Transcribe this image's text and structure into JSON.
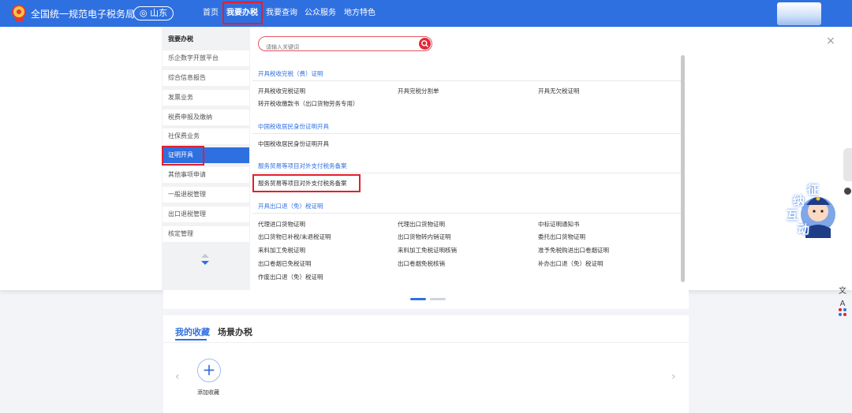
{
  "header": {
    "brand_title": "全国统一规范电子税务局",
    "region_label": "山东",
    "nav_items": [
      {
        "label": "首页"
      },
      {
        "label": "我要办税",
        "active": true
      },
      {
        "label": "我要查询"
      },
      {
        "label": "公众服务"
      },
      {
        "label": "地方特色"
      }
    ]
  },
  "sidebar": {
    "title": "我要办税",
    "items": [
      {
        "label": "乐企数字开放平台"
      },
      {
        "label": "综合信息报告"
      },
      {
        "label": "发票业务"
      },
      {
        "label": "税费申报及缴纳"
      },
      {
        "label": "社保费业务"
      },
      {
        "label": "证明开具",
        "active": true
      },
      {
        "label": "其他事项申请"
      },
      {
        "label": "一般退税管理"
      },
      {
        "label": "出口退税管理"
      },
      {
        "label": "核定管理"
      }
    ]
  },
  "search": {
    "placeholder": "请输入关键词"
  },
  "sections": [
    {
      "title": "开具税收完税（费）证明",
      "items": [
        "开具税收完税证明",
        "开具完税分割单",
        "开具无欠税证明",
        "转开税收缴款书（出口货物劳务专用）"
      ]
    },
    {
      "title": "中国税收居民身份证明开具",
      "items": [
        "中国税收居民身份证明开具"
      ]
    },
    {
      "title": "服务贸易等项目对外支付税务备案",
      "items": [
        "服务贸易等项目对外支付税务备案"
      ]
    },
    {
      "title": "开具出口退（免）税证明",
      "items": [
        "代理进口货物证明",
        "代理出口货物证明",
        "中标证明通知书",
        "出口货物已补税/未退税证明",
        "出口货物转内销证明",
        "委托出口货物证明",
        "来料加工免税证明",
        "来料加工免税证明核销",
        "准予免税购进出口卷烟证明",
        "出口卷烟已免税证明",
        "出口卷烟免税核销",
        "补办出口退（免）税证明",
        "作废出口退（免）税证明"
      ]
    }
  ],
  "mascot": {
    "chars": [
      "征",
      "纳",
      "互",
      "动"
    ]
  },
  "bottom": {
    "tabs": [
      {
        "label": "我的收藏",
        "active": true
      },
      {
        "label": "场景办税"
      }
    ],
    "add_favorite_label": "添加收藏"
  },
  "colors": {
    "primary": "#2f70e0",
    "highlight": "#e0202e"
  },
  "icons": [
    "national-emblem-icon",
    "location-pin-icon",
    "search-icon",
    "close-icon",
    "sort-arrows-icon",
    "accessibility-icon",
    "grid-app-icon",
    "plus-icon",
    "chevron-left-icon",
    "chevron-right-icon"
  ]
}
